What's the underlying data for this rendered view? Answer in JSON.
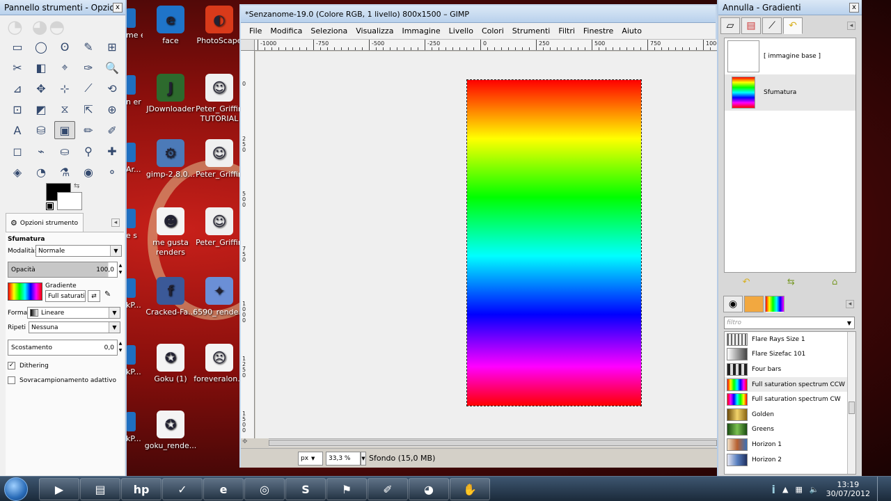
{
  "desktop": {
    "icons": [
      {
        "label": "face",
        "color": "#1f74c9",
        "glyph": "e"
      },
      {
        "label": "PhotoScape",
        "color": "#d93a1a",
        "glyph": "◐"
      },
      {
        "label": "JDownloader",
        "color": "#2d6a2d",
        "glyph": "J"
      },
      {
        "label": "Peter_Griffin TUTORIAL",
        "color": "#f0f0f0",
        "glyph": "☺"
      },
      {
        "label": "gimp-2.8.0...",
        "color": "#4c7ab8",
        "glyph": "⚙"
      },
      {
        "label": "Peter_Griffin",
        "color": "#f0f0f0",
        "glyph": "☺"
      },
      {
        "label": "me gusta renders",
        "color": "#f4f4f4",
        "glyph": "☻"
      },
      {
        "label": "Peter_Griffin",
        "color": "#f0f0f0",
        "glyph": "☺"
      },
      {
        "label": "Cracked-Fa...",
        "color": "#3b5998",
        "glyph": "f"
      },
      {
        "label": "6590_rende...",
        "color": "#6b8fd6",
        "glyph": "✦"
      },
      {
        "label": "Goku (1)",
        "color": "#f4f4f4",
        "glyph": "✪"
      },
      {
        "label": "foreveralon...",
        "color": "#f4f4f4",
        "glyph": "☹"
      },
      {
        "label": "goku_rende...",
        "color": "#f4f4f4",
        "glyph": "✪"
      }
    ],
    "edge_labels": [
      "me er",
      "n er",
      "Ar...",
      "e s",
      "kP...",
      "kP...",
      "kP..."
    ]
  },
  "toolbox": {
    "title": "Pannello strumenti - Opzioni ...",
    "close": "x",
    "logo": "wilber",
    "tools": [
      "▭",
      "◯",
      "ʘ",
      "✎",
      "⊞",
      "✂",
      "◧",
      "⌖",
      "✑",
      "🔍",
      "⊿",
      "✥",
      "⊹",
      "⟋",
      "⟲",
      "⊡",
      "◩",
      "⧖",
      "⇱",
      "⊕",
      "A",
      "⛁",
      "▣",
      "✏",
      "✐",
      "◻",
      "⌁",
      "⛀",
      "⚲",
      "✚",
      "◈",
      "◔",
      "⚗",
      "◉",
      "⚬"
    ],
    "active_tool_index": 22,
    "options_tab": "Opzioni strumento",
    "options_title": "Sfumatura",
    "mode_label": "Modalità:",
    "mode_value": "Normale",
    "opacity_label": "Opacità",
    "opacity_value": "100,0",
    "gradient_label": "Gradiente",
    "gradient_value": "Full saturation",
    "shape_label": "Forma:",
    "shape_value": "Lineare",
    "repeat_label": "Ripeti",
    "repeat_value": "Nessuna",
    "offset_label": "Scostamento",
    "offset_value": "0,0",
    "dithering_label": "Dithering",
    "supersample_label": "Sovracampionamento adattivo"
  },
  "image_window": {
    "title": "*Senzanome-19.0 (Colore RGB, 1 livello) 800x1500 – GIMP",
    "menu": [
      "File",
      "Modifica",
      "Seleziona",
      "Visualizza",
      "Immagine",
      "Livello",
      "Colori",
      "Strumenti",
      "Filtri",
      "Finestre",
      "Aiuto"
    ],
    "ruler_h_labels": [
      "-1000",
      "-750",
      "-500",
      "-250",
      "0",
      "250",
      "500",
      "750",
      "1000"
    ],
    "ruler_v_labels": [
      "0",
      "250",
      "500",
      "750",
      "1000",
      "1250",
      "1500"
    ],
    "unit": "px",
    "zoom": "33,3 %",
    "status": "Sfondo (15,0 MB)"
  },
  "dock": {
    "title": "Annulla - Gradienti",
    "history": [
      {
        "label": "[ immagine base ]"
      },
      {
        "label": "Sfumatura"
      }
    ],
    "filter_placeholder": "filtro",
    "gradients": [
      {
        "name": "Flare Rays Size 1",
        "style": "repeating-linear-gradient(90deg,#666 0 2px,#eee 2px 5px)"
      },
      {
        "name": "Flare Sizefac 101",
        "style": "linear-gradient(90deg,#fff,#444)"
      },
      {
        "name": "Four bars",
        "style": "repeating-linear-gradient(90deg,#222 0 4px,#ddd 4px 8px)"
      },
      {
        "name": "Full saturation spectrum CCW",
        "style": "linear-gradient(90deg,#f00,#ff0,#0f0,#0ff,#00f,#f0f,#f00)"
      },
      {
        "name": "Full saturation spectrum CW",
        "style": "linear-gradient(90deg,#f00,#f0f,#00f,#0ff,#0f0,#ff0,#f00)"
      },
      {
        "name": "Golden",
        "style": "linear-gradient(90deg,#6b4a0a,#f2d36a,#8a6410)"
      },
      {
        "name": "Greens",
        "style": "linear-gradient(90deg,#1b4d12,#7ac050,#1b4d12)"
      },
      {
        "name": "Horizon 1",
        "style": "linear-gradient(90deg,#f2e2c8,#b86030,#3a70b8)"
      },
      {
        "name": "Horizon 2",
        "style": "linear-gradient(90deg,#e8e8f4,#5880c0,#203060)"
      }
    ],
    "selected_gradient_index": 3
  },
  "taskbar": {
    "buttons": [
      "▶",
      "▤",
      "hp",
      "✓",
      "e",
      "◎",
      "S",
      "⚑",
      "✐",
      "◕",
      "✋"
    ],
    "clock_time": "13:19",
    "clock_date": "30/07/2012"
  }
}
